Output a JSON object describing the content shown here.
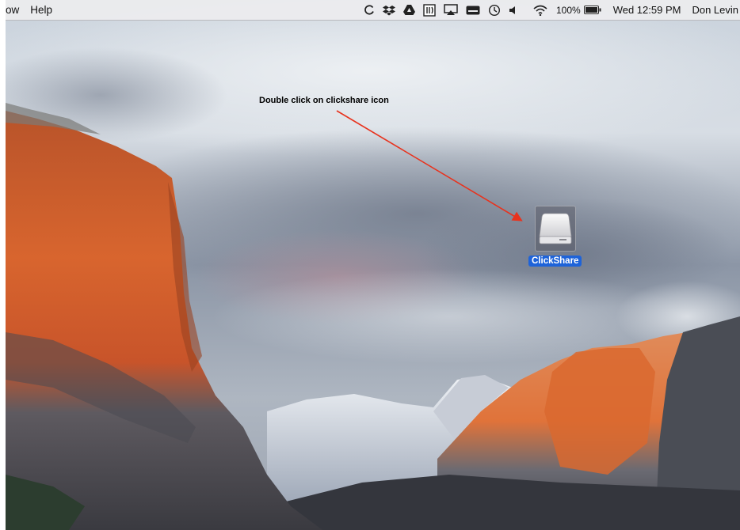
{
  "menubar": {
    "left_items": [
      "ow",
      "Help"
    ],
    "battery_percent": "100%",
    "clock": "Wed 12:59 PM",
    "user": "Don Levin",
    "tray_icons": [
      "sync-icon",
      "dropbox-icon",
      "google-drive-icon",
      "app-icon",
      "airplay-icon",
      "keyboard-icon",
      "time-machine-icon",
      "volume-icon",
      "wifi-icon",
      "battery-icon"
    ]
  },
  "annotation": {
    "text": "Double click on clickshare icon",
    "color": "#e8331e"
  },
  "desktop": {
    "drive_label": "ClickShare",
    "selection_color": "#1e63d9"
  }
}
